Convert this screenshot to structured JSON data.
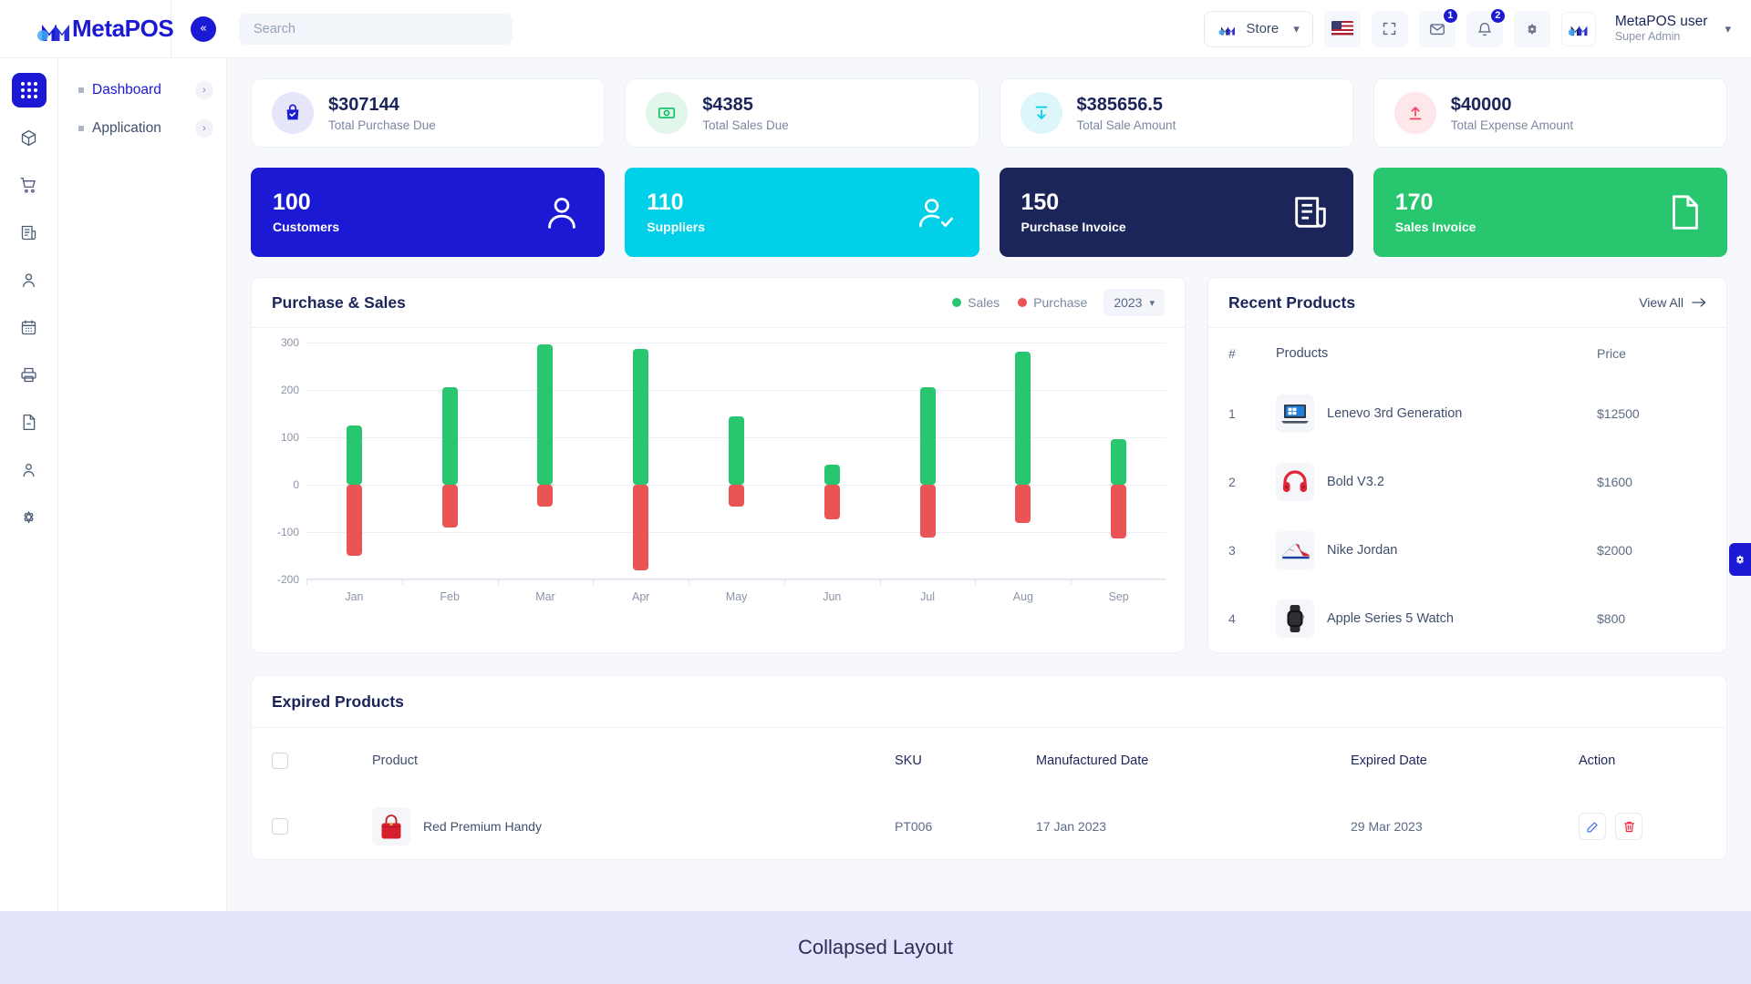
{
  "header": {
    "brand": "MetaPOS",
    "collapse_icon": "chevrons-left-icon",
    "search_placeholder": "Search",
    "store_label": "Store",
    "flag_icon": "us-flag-icon",
    "fullscreen_icon": "fullscreen-icon",
    "mail_icon": "mail-icon",
    "mail_badge": "1",
    "bell_icon": "bell-icon",
    "bell_badge": "2",
    "settings_icon": "gear-icon",
    "user_name": "MetaPOS user",
    "user_role": "Super Admin"
  },
  "rail": {
    "items": [
      {
        "icon": "grid-apps-icon",
        "active": true
      },
      {
        "icon": "box-package-icon",
        "active": false
      },
      {
        "icon": "shopping-cart-icon",
        "active": false
      },
      {
        "icon": "invoice-list-icon",
        "active": false
      },
      {
        "icon": "user-icon",
        "active": false
      },
      {
        "icon": "calendar-icon",
        "active": false
      },
      {
        "icon": "printer-icon",
        "active": false
      },
      {
        "icon": "file-minus-icon",
        "active": false
      },
      {
        "icon": "user-outline-icon",
        "active": false
      },
      {
        "icon": "gear-icon",
        "active": false
      }
    ]
  },
  "subnav": {
    "items": [
      {
        "label": "Dashboard",
        "active": true
      },
      {
        "label": "Application",
        "active": false
      }
    ],
    "chevron_icon": "chevron-right-icon"
  },
  "stats": [
    {
      "value": "$307144",
      "label": "Total Purchase Due",
      "icon": "bag-check-icon",
      "color": "#1b19d4",
      "bg": "#e6e6fb"
    },
    {
      "value": "$4385",
      "label": "Total Sales Due",
      "icon": "cash-icon",
      "color": "#0fbf61",
      "bg": "#e1f7ec"
    },
    {
      "value": "$385656.5",
      "label": "Total Sale Amount",
      "icon": "arrow-down-tray-icon",
      "color": "#00cfe8",
      "bg": "#ddf6fb"
    },
    {
      "value": "$40000",
      "label": "Total Expense Amount",
      "icon": "arrow-up-tray-icon",
      "color": "#f0465a",
      "bg": "#fde7ea"
    }
  ],
  "kpis": [
    {
      "number": "100",
      "label": "Customers",
      "bg": "#1b19d4",
      "icon": "person-icon"
    },
    {
      "number": "110",
      "label": "Suppliers",
      "bg": "#00d0e8",
      "icon": "person-check-icon"
    },
    {
      "number": "150",
      "label": "Purchase Invoice",
      "bg": "#1b2559",
      "icon": "invoice-icon"
    },
    {
      "number": "170",
      "label": "Sales Invoice",
      "bg": "#28c76f",
      "icon": "document-icon"
    }
  ],
  "chart_panel": {
    "title": "Purchase & Sales",
    "year": "2023",
    "year_caret_icon": "chevron-down-icon"
  },
  "chart_data": {
    "type": "bar",
    "title": "Purchase & Sales",
    "categories": [
      "Jan",
      "Feb",
      "Mar",
      "Apr",
      "May",
      "Jun",
      "Jul",
      "Aug",
      "Sep"
    ],
    "series": [
      {
        "name": "Sales",
        "color": "#28c76f",
        "values": [
          125,
          205,
          297,
          287,
          145,
          42,
          205,
          280,
          97
        ]
      },
      {
        "name": "Purchase",
        "color": "#ea5455",
        "values": [
          -150,
          -90,
          -47,
          -180,
          -47,
          -73,
          -112,
          -80,
          -113
        ]
      }
    ],
    "ylim": [
      -200,
      300
    ],
    "yticks": [
      300,
      200,
      100,
      0,
      -100,
      -200
    ],
    "xlabel": "",
    "ylabel": "",
    "grid": true,
    "legend": [
      "Sales",
      "Purchase"
    ],
    "legend_position": "top-right"
  },
  "recent_products": {
    "title": "Recent Products",
    "view_all": "View All",
    "view_all_icon": "arrow-right-icon",
    "columns": [
      "#",
      "Products",
      "Price"
    ],
    "rows": [
      {
        "num": "1",
        "name": "Lenevo 3rd Generation",
        "price": "$12500",
        "thumb": "laptop-icon"
      },
      {
        "num": "2",
        "name": "Bold V3.2",
        "price": "$1600",
        "thumb": "headphones-icon"
      },
      {
        "num": "3",
        "name": "Nike Jordan",
        "price": "$2000",
        "thumb": "sneaker-icon"
      },
      {
        "num": "4",
        "name": "Apple Series 5 Watch",
        "price": "$800",
        "thumb": "watch-icon"
      }
    ]
  },
  "expired_products": {
    "title": "Expired Products",
    "columns": [
      "",
      "Product",
      "SKU",
      "Manufactured Date",
      "Expired Date",
      "Action"
    ],
    "rows": [
      {
        "product": "Red Premium Handy",
        "sku": "PT006",
        "manufactured": "17 Jan 2023",
        "expired": "29 Mar 2023",
        "thumb": "handbag-icon",
        "edit_icon": "edit-icon",
        "delete_icon": "trash-icon"
      }
    ]
  },
  "footer": {
    "text": "Collapsed Layout"
  },
  "settings_tab": {
    "icon": "gear-icon"
  }
}
